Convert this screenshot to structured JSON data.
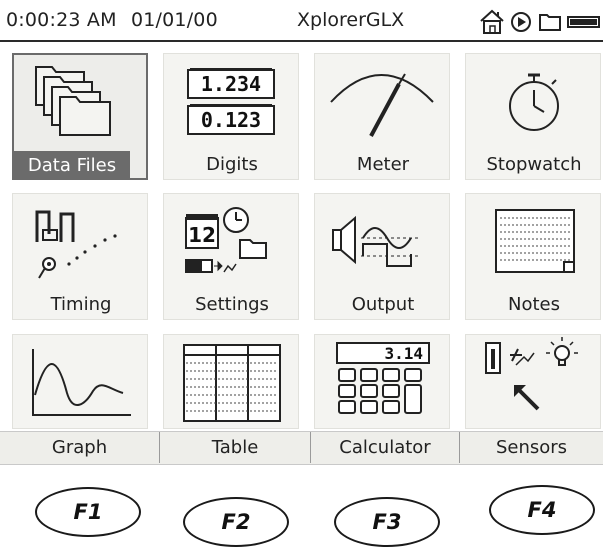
{
  "status_bar": {
    "time": "0:00:23 AM",
    "date": "01/01/00",
    "app_title": "XplorerGLX"
  },
  "tiles": [
    {
      "label": "Data Files",
      "icon": "folders-icon",
      "selected": true
    },
    {
      "label": "Digits",
      "icon": "digits-icon",
      "readout_top": "1.234",
      "readout_bottom": "0.123"
    },
    {
      "label": "Meter",
      "icon": "meter-icon"
    },
    {
      "label": "Stopwatch",
      "icon": "stopwatch-icon"
    },
    {
      "label": "Timing",
      "icon": "timing-icon"
    },
    {
      "label": "Settings",
      "icon": "settings-icon",
      "calendar_number": "12"
    },
    {
      "label": "Output",
      "icon": "output-icon"
    },
    {
      "label": "Notes",
      "icon": "notes-icon"
    },
    {
      "label": "",
      "icon": "graph-icon"
    },
    {
      "label": "",
      "icon": "table-icon"
    },
    {
      "label": "",
      "icon": "calculator-icon",
      "display_value": "3.14"
    },
    {
      "label": "",
      "icon": "sensors-icon"
    }
  ],
  "softkeys": [
    "Graph",
    "Table",
    "Calculator",
    "Sensors"
  ],
  "function_keys": [
    "F1",
    "F2",
    "F3",
    "F4"
  ],
  "colors": {
    "selected_label_bg": "#6b6b6b",
    "tile_bg": "#f4f4f1",
    "softkey_bar_bg": "#eeeeea"
  }
}
